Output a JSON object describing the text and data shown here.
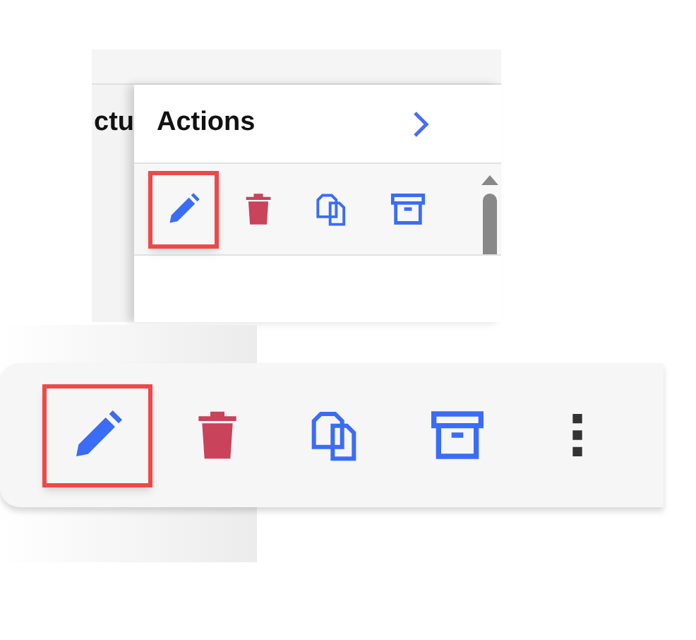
{
  "top_panel": {
    "partial_column_header": "ctu",
    "title": "Actions",
    "actions": [
      {
        "kind": "edit",
        "highlighted": true
      },
      {
        "kind": "delete",
        "highlighted": false
      },
      {
        "kind": "copy",
        "highlighted": false
      },
      {
        "kind": "archive",
        "highlighted": false
      }
    ]
  },
  "toolbar": {
    "actions": [
      {
        "kind": "edit",
        "highlighted": true
      },
      {
        "kind": "delete",
        "highlighted": false
      },
      {
        "kind": "copy",
        "highlighted": false
      },
      {
        "kind": "archive",
        "highlighted": false
      },
      {
        "kind": "more",
        "highlighted": false
      }
    ]
  }
}
